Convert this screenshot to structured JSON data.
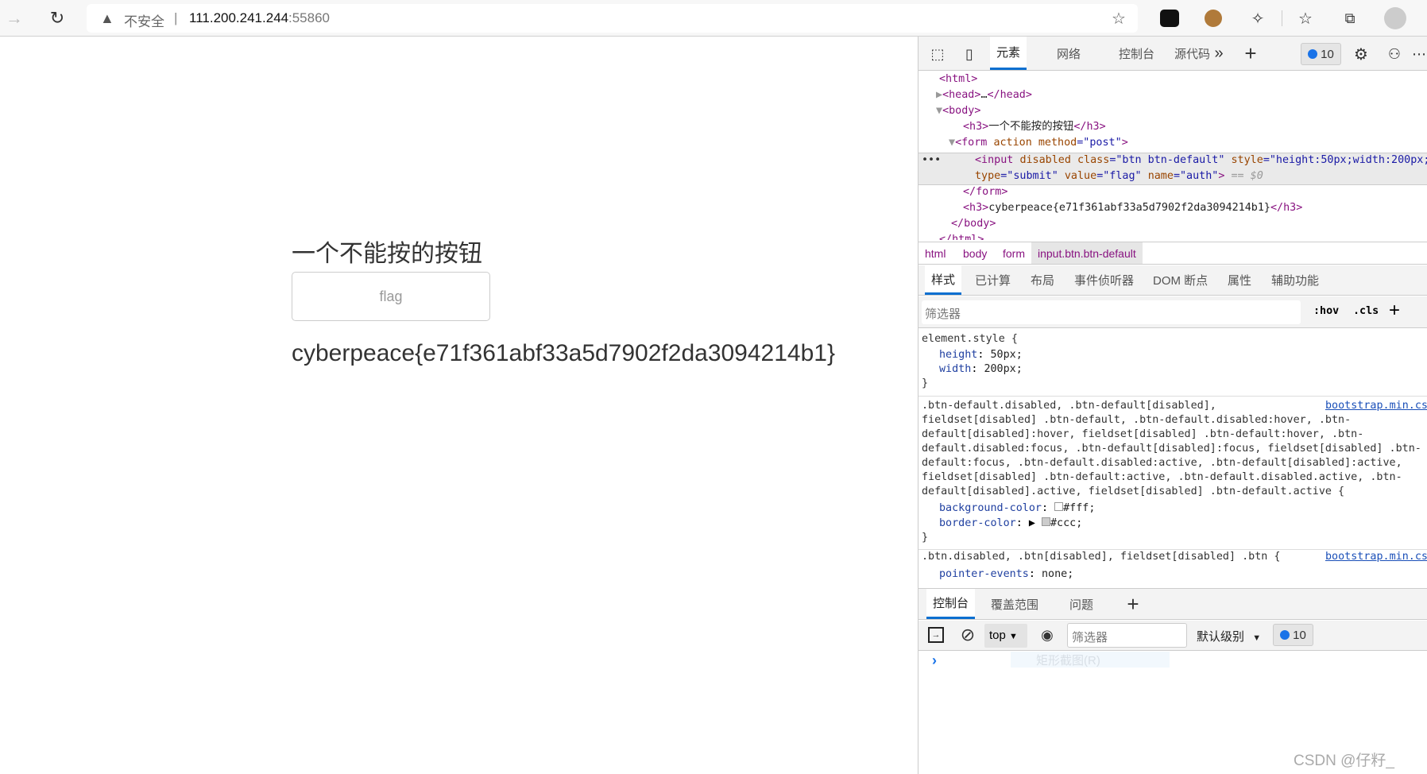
{
  "browser": {
    "security_label": "不安全",
    "url_host": "111.200.241.244",
    "url_port": ":55860",
    "icons": [
      "back-icon",
      "reload-icon",
      "warning-icon",
      "add-favorite-icon",
      "extension-tampermonkey-icon",
      "extension-cookie-icon",
      "extensions-icon",
      "favorites-icon",
      "collections-icon",
      "profile-avatar-icon"
    ]
  },
  "page": {
    "heading": "一个不能按的按钮",
    "button_label": "flag",
    "flag_text": "cyberpeace{e71f361abf33a5d7902f2da3094214b1}"
  },
  "devtools": {
    "tabs": [
      "元素",
      "网络",
      "控制台",
      "源代码"
    ],
    "active_tab": "元素",
    "message_count": "10",
    "dom": {
      "l0": "<html>",
      "l1a": "<head>",
      "l1b": "…",
      "l1c": "</head>",
      "l2": "<body>",
      "l3a": "<h3>",
      "l3b": "一个不能按的按钮",
      "l3c": "</h3>",
      "l4a": "<form ",
      "l4b": "action ",
      "l4c": "method",
      "l4d": "=\"post\"",
      "l4e": ">",
      "l5a": "<input ",
      "l5b": "disabled ",
      "l5c": "class",
      "l5d": "=\"btn btn-default\" ",
      "l5e": "style",
      "l5f": "=\"height:50px;width:200px;",
      "l6a": "type",
      "l6b": "=\"submit\" ",
      "l6c": "value",
      "l6d": "=\"flag\" ",
      "l6e": "name",
      "l6f": "=\"auth\"",
      "l6g": ">",
      "l6h": " == $0",
      "l7": "</form>",
      "l8a": "<h3>",
      "l8b": "cyberpeace{e71f361abf33a5d7902f2da3094214b1}",
      "l8c": "</h3>",
      "l9": "</body>",
      "l10": "</html>"
    },
    "breadcrumb": [
      "html",
      "body",
      "form",
      "input.btn.btn-default"
    ],
    "style_tabs": [
      "样式",
      "已计算",
      "布局",
      "事件侦听器",
      "DOM 断点",
      "属性",
      "辅助功能"
    ],
    "styles_filter_placeholder": "筛选器",
    "hov": ":hov",
    "cls": ".cls",
    "rules": {
      "r1_sel": "element.style {",
      "r1_p1": "height",
      "r1_v1": "50px;",
      "r1_p2": "width",
      "r1_v2": "200px;",
      "close": "}",
      "r2_lines": [
        ".btn-default.disabled, .btn-default[disabled],",
        "fieldset[disabled] .btn-default, .btn-default.disabled:hover, .btn-",
        "default[disabled]:hover, fieldset[disabled] .btn-default:hover, .btn-",
        "default.disabled:focus, .btn-default[disabled]:focus, fieldset[disabled] .btn-",
        "default:focus, .btn-default.disabled:active, .btn-default[disabled]:active,",
        "fieldset[disabled] .btn-default:active, .btn-default.disabled.active, .btn-",
        "default[disabled].active, fieldset[disabled] .btn-default.active {"
      ],
      "r2_p1": "background-color",
      "r2_v1": "#fff;",
      "r2_p2": "border-color",
      "r2_v2": "#ccc;",
      "source": "bootstrap.min.css",
      "r3_sel": ".btn.disabled, .btn[disabled], fieldset[disabled] .btn {",
      "r3_p1": "pointer-events",
      "r3_v1": "none;"
    },
    "colors": {
      "swatch_bg": "#fff",
      "swatch_border": "#ccc",
      "accent": "#0a6fd0"
    },
    "drawer_tabs": [
      "控制台",
      "覆盖范围",
      "问题"
    ],
    "console": {
      "context": "top",
      "filter_placeholder": "筛选器",
      "level": "默认级别",
      "message_count": "10",
      "ghost_tooltip": "矩形截图(R)"
    }
  },
  "watermark": "CSDN @仔籽_"
}
